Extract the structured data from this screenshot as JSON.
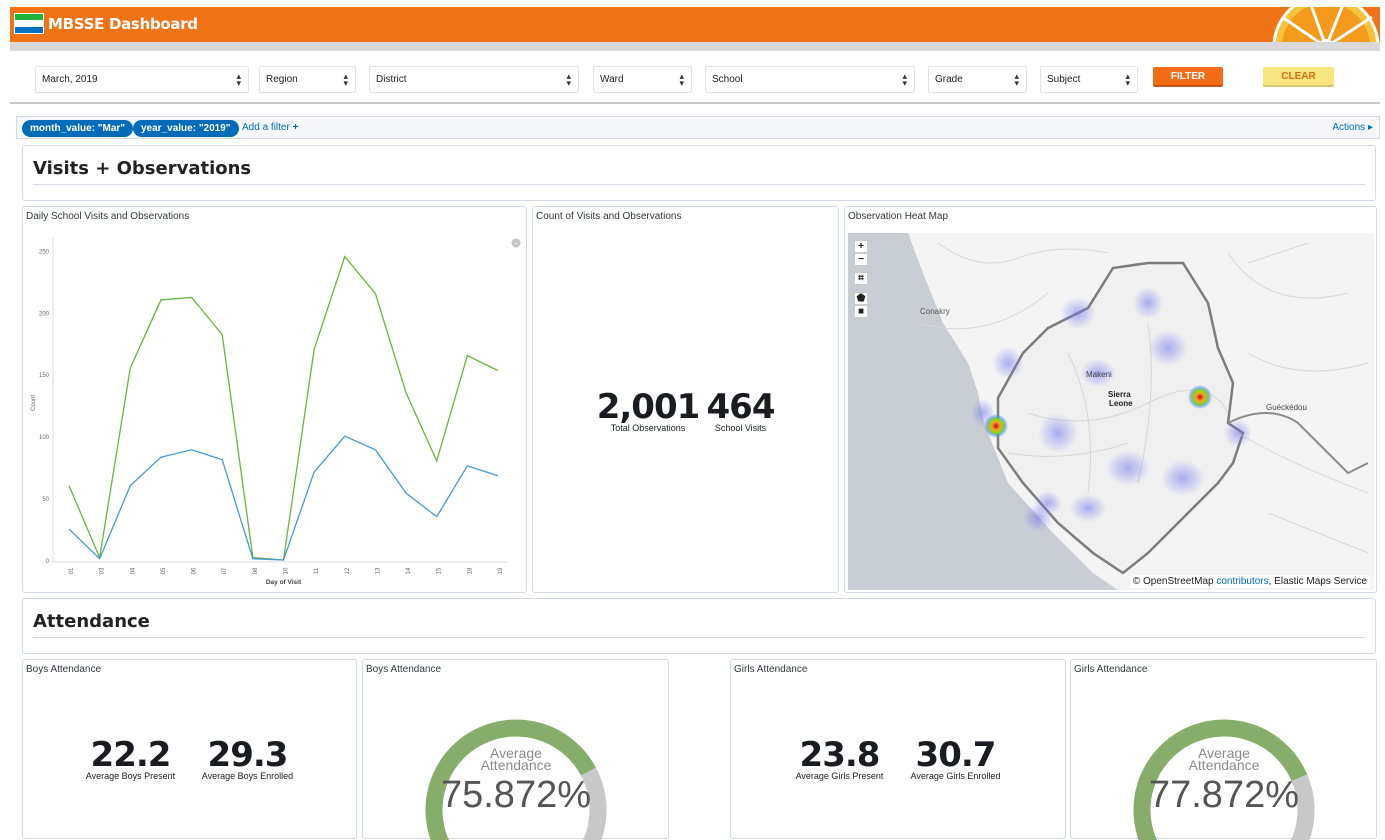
{
  "header": {
    "title": "MBSSE Dashboard",
    "flag_colors": [
      "#1eb53a",
      "#ffffff",
      "#0072c6"
    ],
    "accent": "#f07416"
  },
  "filters": {
    "month": "March, 2019",
    "region": "Region",
    "district": "District",
    "ward": "Ward",
    "school": "School",
    "grade": "Grade",
    "subject": "Subject",
    "filter_label": "FILTER",
    "clear_label": "CLEAR"
  },
  "query_bar": {
    "pills": [
      "month_value: \"Mar\"",
      "year_value: \"2019\""
    ],
    "add_filter": "Add a filter",
    "actions": "Actions"
  },
  "visits_section": {
    "title": "Visits + Observations",
    "line_chart_title": "Daily School Visits and Observations",
    "count_title": "Count of Visits and Observations",
    "total_observations": "2,001",
    "total_observations_label": "Total Observations",
    "school_visits": "464",
    "school_visits_label": "School Visits",
    "map_title": "Observation Heat Map",
    "map_labels": [
      "Conakry",
      "Makeni",
      "Sierra",
      "Leone",
      "Guéckédou"
    ],
    "map_attribution_prefix": "© OpenStreetMap",
    "map_attribution_link": "contributors",
    "map_attribution_suffix": ", Elastic Maps Service"
  },
  "chart_data": {
    "type": "line",
    "title": "",
    "xlabel": "Day of Visit",
    "ylabel": "Count",
    "categories": [
      "01",
      "03",
      "04",
      "05",
      "06",
      "07",
      "08",
      "10",
      "11",
      "12",
      "13",
      "14",
      "15",
      "18",
      "19"
    ],
    "ylim": [
      0,
      260
    ],
    "yticks": [
      0,
      50,
      100,
      150,
      200,
      250
    ],
    "series": [
      {
        "color": "#6db33f",
        "values": [
          60,
          2,
          155,
          210,
          212,
          182,
          2,
          0,
          170,
          245,
          215,
          135,
          80,
          165,
          153
        ]
      },
      {
        "color": "#4a98d3",
        "values": [
          25,
          1,
          60,
          83,
          89,
          81,
          1,
          0,
          71,
          100,
          89,
          54,
          35,
          76,
          68
        ]
      }
    ]
  },
  "attendance_section": {
    "title": "Attendance",
    "boys_title": "Boys Attendance",
    "boys_present": "22.2",
    "boys_present_label": "Average Boys Present",
    "boys_enrolled": "29.3",
    "boys_enrolled_label": "Average Boys Enrolled",
    "boys_gauge_title": "Boys Attendance",
    "boys_gauge_label1": "Average",
    "boys_gauge_label2": "Attendance",
    "boys_gauge_value": "75.872%",
    "boys_gauge_fraction": 0.75872,
    "girls_title": "Girls Attendance",
    "girls_present": "23.8",
    "girls_present_label": "Average Girls Present",
    "girls_enrolled": "30.7",
    "girls_enrolled_label": "Average Girls Enrolled",
    "girls_gauge_title": "Girls Attendance",
    "girls_gauge_label1": "Average",
    "girls_gauge_label2": "Attendance",
    "girls_gauge_value": "77.872%",
    "girls_gauge_fraction": 0.77872,
    "gauge_fill_color": "#86ad6a",
    "gauge_empty_color": "#c8c8c8"
  }
}
